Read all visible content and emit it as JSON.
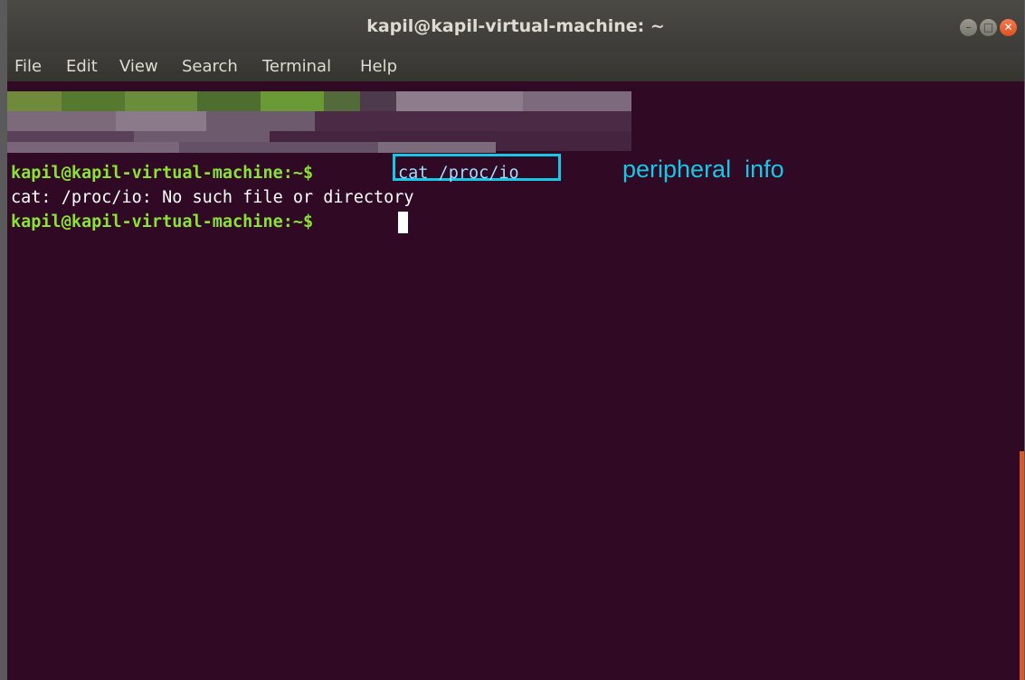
{
  "window": {
    "title": "kapil@kapil-virtual-machine: ~",
    "controls": [
      "minimize-icon",
      "maximize-icon",
      "close-icon"
    ]
  },
  "menubar": [
    "File",
    "Edit",
    "View",
    "Search",
    "Terminal",
    "Help"
  ],
  "terminal": {
    "prompt": "kapil@kapil-virtual-machine:~$",
    "command": "cat /proc/io",
    "error_output": "cat: /proc/io: No such file or directory",
    "prompt2": "kapil@kapil-virtual-machine:~$",
    "annotation": "peripheral  info"
  },
  "colors": {
    "background": "#300a24",
    "prompt": "#8ae234",
    "annotation": "#18c7e6"
  }
}
